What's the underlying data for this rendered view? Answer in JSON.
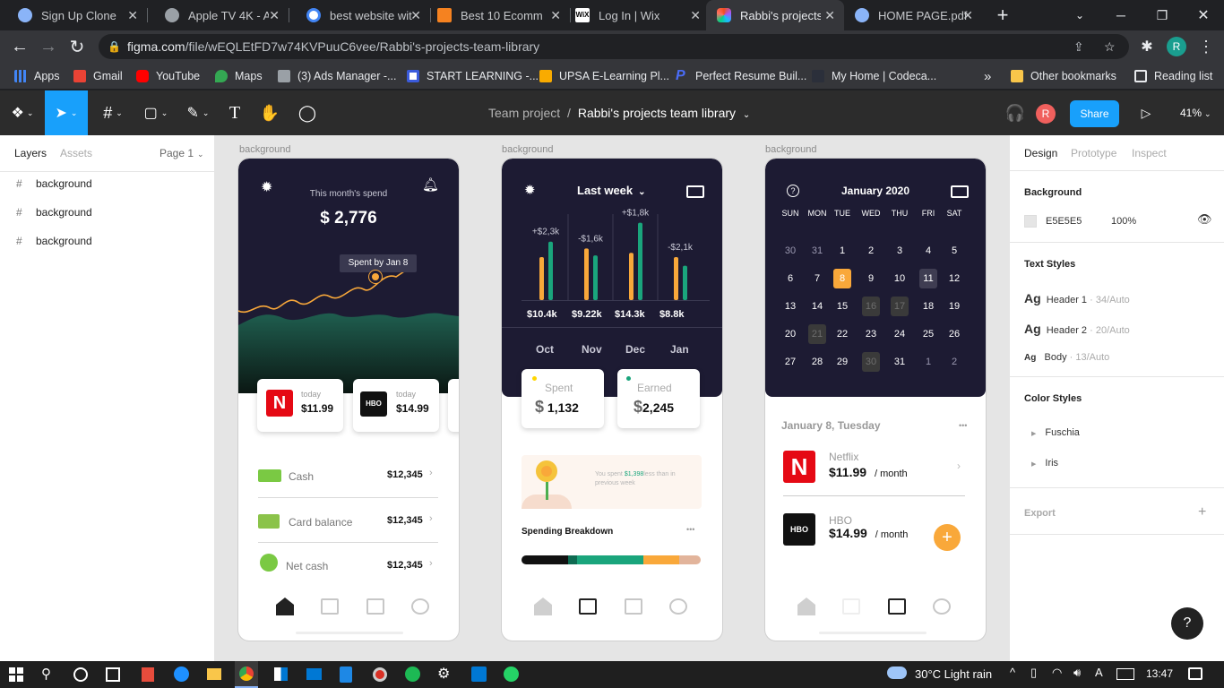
{
  "browser": {
    "tabs": [
      {
        "title": "Sign Up Clone",
        "color": "#8ab4f8"
      },
      {
        "title": "Apple TV 4K - Ap",
        "color": "#9aa0a6"
      },
      {
        "title": "best website with",
        "color": "#4285f4"
      },
      {
        "title": "Best 10 Ecommer",
        "color": "#f58220"
      },
      {
        "title": "Log In | Wix",
        "color": "#ffffff"
      },
      {
        "title": "Rabbi's projects t",
        "color": "#a259ff"
      },
      {
        "title": "HOME PAGE.pdf",
        "color": "#8ab4f8"
      }
    ],
    "new_tab": "+",
    "url_host": "figma.com",
    "url_path": "/file/wEQLEtFD7w74KVPuuC6vee/Rabbi's-projects-team-library",
    "profile_initial": "R",
    "bookmarks": [
      {
        "label": "Apps",
        "color": "#4285f4"
      },
      {
        "label": "Gmail",
        "color": "#ea4335"
      },
      {
        "label": "YouTube",
        "color": "#ff0000"
      },
      {
        "label": "Maps",
        "color": "#34a853"
      },
      {
        "label": "(3) Ads Manager -...",
        "color": "#9aa0a6"
      },
      {
        "label": "START LEARNING -...",
        "color": "#ffffff"
      },
      {
        "label": "UPSA E-Learning Pl...",
        "color": "#f9ab00"
      },
      {
        "label": "Perfect Resume Buil...",
        "color": "#4a6cf7"
      },
      {
        "label": "My Home | Codeca...",
        "color": "#2b2f3a"
      }
    ],
    "overflow": "»",
    "other_bookmarks": "Other bookmarks",
    "reading_list": "Reading list"
  },
  "figma": {
    "breadcrumb_team": "Team project",
    "breadcrumb_sep": "/",
    "file_name": "Rabbi's projects team library",
    "share_label": "Share",
    "avatar": "R",
    "zoom": "41%",
    "layers_tab": "Layers",
    "assets_tab": "Assets",
    "page": "Page 1",
    "layers": [
      "background",
      "background",
      "background"
    ],
    "design_tab": "Design",
    "prototype_tab": "Prototype",
    "inspect_tab": "Inspect",
    "background_title": "Background",
    "background_hex": "E5E5E5",
    "background_opacity": "100%",
    "text_styles_title": "Text Styles",
    "text_styles": [
      {
        "name": "Header 1",
        "spec": " · 34/Auto"
      },
      {
        "name": "Header 2",
        "spec": " · 20/Auto"
      },
      {
        "name": "Body",
        "spec": " · 13/Auto"
      }
    ],
    "color_styles_title": "Color Styles",
    "color_styles": [
      "Fuschia",
      "Iris"
    ],
    "export_title": "Export",
    "help": "?"
  },
  "frames": {
    "labels": [
      "background",
      "background",
      "background"
    ],
    "f1": {
      "spend_label": "This month's spend",
      "spend_value": "$ 2,776",
      "tooltip": "Spent by Jan 8",
      "subs": [
        {
          "icon": "N",
          "small": "today",
          "price": "$11.99"
        },
        {
          "icon": "HBO",
          "small": "today",
          "price": "$14.99"
        }
      ],
      "rows": [
        {
          "label": "Cash",
          "value": "$12,345"
        },
        {
          "label": "Card balance",
          "value": "$12,345"
        },
        {
          "label": "Net cash",
          "value": "$12,345"
        }
      ]
    },
    "f2": {
      "period": "Last week",
      "deltas": [
        "+$2,3k",
        "-$1,6k",
        "+$1,8k",
        "-$2,1k"
      ],
      "totals": [
        "$10.4k",
        "$9.22k",
        "$14.3k",
        "$8.8k"
      ],
      "months": [
        "Oct",
        "Nov",
        "Dec",
        "Jan"
      ],
      "bars": [
        {
          "orange": 0.5,
          "green": 0.68
        },
        {
          "orange": 0.6,
          "green": 0.52
        },
        {
          "orange": 0.55,
          "green": 0.9
        },
        {
          "orange": 0.5,
          "green": 0.4
        }
      ],
      "spent_label": "Spent",
      "spent_value": "1,132",
      "earned_label": "Earned",
      "earned_value": "2,245",
      "promo_pre": "You spent ",
      "promo_amount": "$1,398",
      "promo_post": "less than in previous week",
      "breakdown_title": "Spending Breakdown",
      "more": "•••",
      "breakdown": [
        {
          "color": "#111111",
          "share": 0.26
        },
        {
          "color": "#0e6b52",
          "share": 0.05
        },
        {
          "color": "#1aa57c",
          "share": 0.37
        },
        {
          "color": "#f9a83a",
          "share": 0.2
        },
        {
          "color": "#e2b49b",
          "share": 0.12
        }
      ]
    },
    "f3": {
      "month": "January 2020",
      "weekdays": [
        "SUN",
        "MON",
        "TUE",
        "WED",
        "THU",
        "FRI",
        "SAT"
      ],
      "days": [
        [
          "30",
          "31",
          "1",
          "2",
          "3",
          "4",
          "5"
        ],
        [
          "6",
          "7",
          "8",
          "9",
          "10",
          "11",
          "12"
        ],
        [
          "13",
          "14",
          "15",
          "16",
          "17",
          "18",
          "19"
        ],
        [
          "20",
          "21",
          "22",
          "23",
          "24",
          "25",
          "26"
        ],
        [
          "27",
          "28",
          "29",
          "30",
          "31",
          "1",
          "2"
        ]
      ],
      "date_heading": "January 8, Tuesday",
      "more": "•••",
      "subs": [
        {
          "icon": "N",
          "name": "Netflix",
          "price": "$11.99",
          "period": "/ month"
        },
        {
          "icon": "HBO",
          "name": "HBO",
          "price": "$14.99",
          "period": "/ month"
        }
      ],
      "add": "+"
    }
  },
  "taskbar": {
    "weather": "30°C  Light rain",
    "time": "13:47"
  },
  "colors": {
    "figma_blue": "#18a0fb",
    "frame_dark": "#1d1b33",
    "accent_orange": "#f9a83a",
    "accent_green": "#1aa57c",
    "netflix_red": "#e50914"
  }
}
